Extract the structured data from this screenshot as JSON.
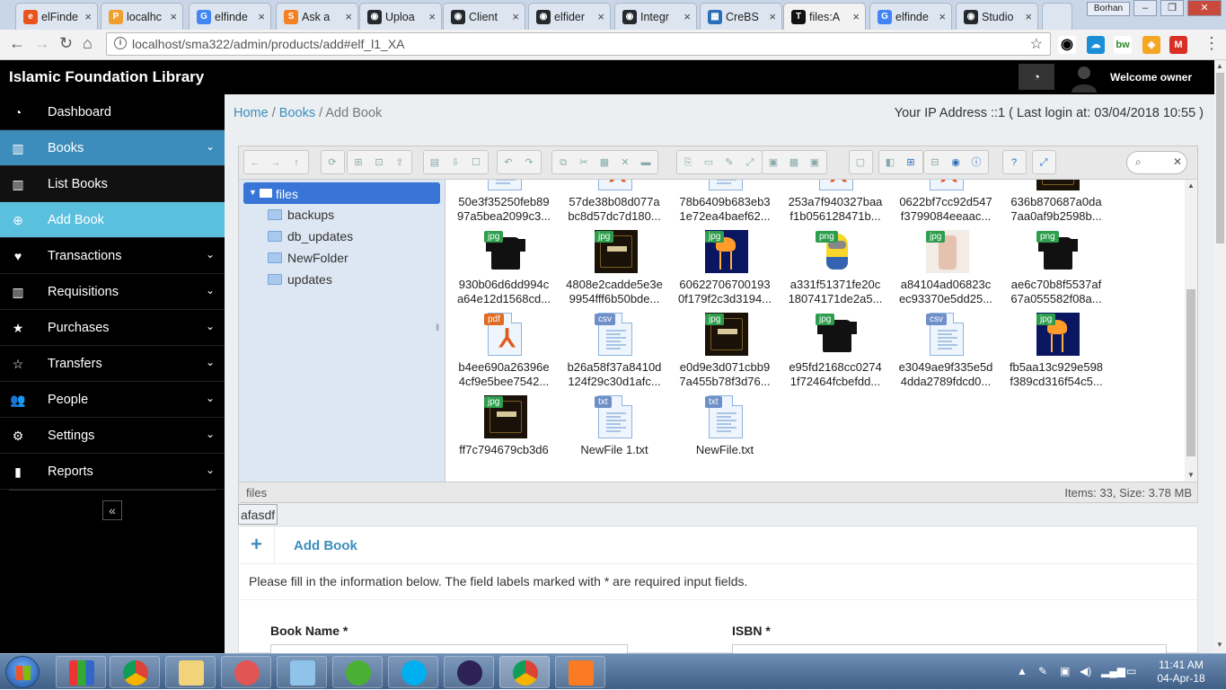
{
  "browser": {
    "tabs": [
      {
        "label": "elFinde",
        "icon": "elfinder-icon",
        "color": "#e8541c",
        "glyph": "e"
      },
      {
        "label": "localhc",
        "icon": "phpmyadmin-icon",
        "color": "#f0a030",
        "glyph": "P"
      },
      {
        "label": "elfinde",
        "icon": "google-icon",
        "color": "#4285f4",
        "glyph": "G"
      },
      {
        "label": "Ask a",
        "icon": "stackoverflow-icon",
        "color": "#f48024",
        "glyph": "S"
      },
      {
        "label": "Uploa",
        "icon": "github-icon",
        "color": "#24292e",
        "glyph": "◉"
      },
      {
        "label": "Client",
        "icon": "github-icon",
        "color": "#24292e",
        "glyph": "◉"
      },
      {
        "label": "elfider",
        "icon": "github-icon",
        "color": "#24292e",
        "glyph": "◉"
      },
      {
        "label": "Integr",
        "icon": "github-icon",
        "color": "#24292e",
        "glyph": "◉"
      },
      {
        "label": "CreBS",
        "icon": "grid-icon",
        "color": "#2a6db8",
        "glyph": "▦"
      },
      {
        "label": "files:A",
        "icon": "typora-icon",
        "color": "#111111",
        "glyph": "T"
      },
      {
        "label": "elfinde",
        "icon": "google-icon",
        "color": "#4285f4",
        "glyph": "G"
      },
      {
        "label": "Studio",
        "icon": "github-icon",
        "color": "#24292e",
        "glyph": "◉"
      }
    ],
    "user_badge": "Borhan",
    "url": "localhost/sma322/admin/products/add#elf_l1_XA"
  },
  "app": {
    "title": "Islamic Foundation Library",
    "welcome": "Welcome owner"
  },
  "sidebar": {
    "items": [
      {
        "label": "Dashboard",
        "icon": "dashboard-icon",
        "glyph": "◔",
        "arrow": false,
        "style": ""
      },
      {
        "label": "Books",
        "icon": "barcode-icon",
        "glyph": "▥",
        "arrow": true,
        "style": "blue"
      },
      {
        "label": "List Books",
        "icon": "barcode-icon",
        "glyph": "▥",
        "arrow": false,
        "style": "sub"
      },
      {
        "label": "Add Book",
        "icon": "plus-circle-icon",
        "glyph": "⊕",
        "arrow": false,
        "style": "active"
      },
      {
        "label": "Transactions",
        "icon": "heart-icon",
        "glyph": "♥",
        "arrow": true,
        "style": ""
      },
      {
        "label": "Requisitions",
        "icon": "barcode-icon",
        "glyph": "▥",
        "arrow": true,
        "style": ""
      },
      {
        "label": "Purchases",
        "icon": "star-icon",
        "glyph": "★",
        "arrow": true,
        "style": ""
      },
      {
        "label": "Transfers",
        "icon": "star-outline-icon",
        "glyph": "☆",
        "arrow": true,
        "style": ""
      },
      {
        "label": "People",
        "icon": "users-icon",
        "glyph": "👥",
        "arrow": true,
        "style": ""
      },
      {
        "label": "Settings",
        "icon": "gear-icon",
        "glyph": "⚙",
        "arrow": true,
        "style": ""
      },
      {
        "label": "Reports",
        "icon": "bar-chart-icon",
        "glyph": "▮",
        "arrow": true,
        "style": ""
      }
    ],
    "collapse_glyph": "«"
  },
  "breadcrumb": {
    "home": "Home",
    "books": "Books",
    "current": "Add Book"
  },
  "ip_info": "Your IP Address ::1 ( Last login at: 03/04/2018 10:55 )",
  "elfinder": {
    "tree": {
      "root": "files",
      "folders": [
        "backups",
        "db_updates",
        "NewFolder",
        "updates"
      ]
    },
    "files": [
      {
        "kind": "csv",
        "name1": "50e3f35250feb89",
        "name2": "97a5bea2099c3..."
      },
      {
        "kind": "pdf",
        "name1": "57de38b08d077a",
        "name2": "bc8d57dc7d180..."
      },
      {
        "kind": "csv",
        "name1": "78b6409b683eb3",
        "name2": "1e72ea4baef62..."
      },
      {
        "kind": "pdf",
        "name1": "253a7f940327baa",
        "name2": "f1b056128471b..."
      },
      {
        "kind": "pdf",
        "name1": "0622bf7cc92d547",
        "name2": "f3799084eeaac..."
      },
      {
        "kind": "book",
        "badge": "jpg",
        "name1": "636b870687a0da",
        "name2": "7aa0af9b2598b..."
      },
      {
        "kind": "shirt",
        "badge": "jpg",
        "name1": "930b06d6dd994c",
        "name2": "a64e12d1568cd..."
      },
      {
        "kind": "book",
        "badge": "jpg",
        "name1": "4808e2cadde5e3e",
        "name2": "9954fff6b50bde..."
      },
      {
        "kind": "jelly",
        "badge": "jpg",
        "name1": "60622706700193",
        "name2": "0f179f2c3d3194..."
      },
      {
        "kind": "minion",
        "badge": "png",
        "name1": "a331f51371fe20c",
        "name2": "18074171de2a5..."
      },
      {
        "kind": "phone",
        "badge": "jpg",
        "name1": "a84104ad06823c",
        "name2": "ec93370e5dd25..."
      },
      {
        "kind": "shirt",
        "badge": "png",
        "name1": "ae6c70b8f5537af",
        "name2": "67a055582f08a..."
      },
      {
        "kind": "pdf",
        "name1": "b4ee690a26396e",
        "name2": "4cf9e5bee7542..."
      },
      {
        "kind": "csv",
        "name1": "b26a58f37a8410d",
        "name2": "124f29c30d1afc..."
      },
      {
        "kind": "book",
        "badge": "jpg",
        "name1": "e0d9e3d071cbb9",
        "name2": "7a455b78f3d76..."
      },
      {
        "kind": "shirt",
        "badge": "jpg",
        "name1": "e95fd2168cc0274",
        "name2": "1f72464fcbefdd..."
      },
      {
        "kind": "csv",
        "name1": "e3049ae9f335e5d",
        "name2": "4dda2789fdcd0..."
      },
      {
        "kind": "jelly",
        "badge": "jpg",
        "name1": "fb5aa13c929e598",
        "name2": "f389cd316f54c5..."
      },
      {
        "kind": "book",
        "badge": "jpg",
        "name1": "ff7c794679cb3d6",
        "name2": ""
      },
      {
        "kind": "txt",
        "name1": "NewFile 1.txt",
        "name2": ""
      },
      {
        "kind": "txt",
        "name1": "NewFile.txt",
        "name2": ""
      }
    ],
    "status_path": "files",
    "status_info": "Items: 33, Size: 3.78 MB"
  },
  "input_echo": "afasdf",
  "form": {
    "title": "Add Book",
    "plus": "+",
    "note": "Please fill in the information below. The field labels marked with * are required input fields.",
    "book_name_label": "Book Name *",
    "isbn_label": "ISBN *"
  },
  "taskbar": {
    "time": "11:41 AM",
    "date": "04-Apr-18"
  }
}
